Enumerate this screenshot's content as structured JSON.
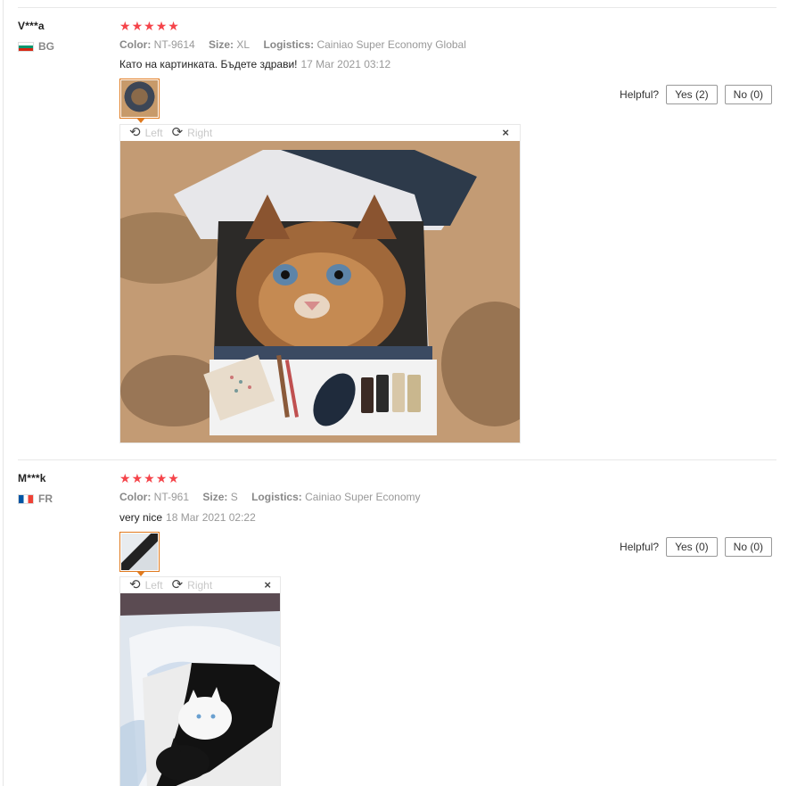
{
  "reviews": [
    {
      "user": "V***a",
      "country": "BG",
      "rating": 5,
      "attributes": {
        "color_label": "Color:",
        "color_value": "NT-9614",
        "size_label": "Size:",
        "size_value": "XL",
        "logistics_label": "Logistics:",
        "logistics_value": "Cainiao Super Economy Global"
      },
      "text": "Като на картинката. Бъдете здрави!",
      "date": "17 Mar 2021 03:12",
      "helpful_label": "Helpful?",
      "yes_label": "Yes (2)",
      "no_label": "No (0)",
      "viewer": {
        "left_label": "Left",
        "right_label": "Right",
        "close_label": "×"
      }
    },
    {
      "user": "M***k",
      "country": "FR",
      "rating": 5,
      "attributes": {
        "color_label": "Color:",
        "color_value": "NT-961",
        "size_label": "Size:",
        "size_value": "S",
        "logistics_label": "Logistics:",
        "logistics_value": "Cainiao Super Economy"
      },
      "text": "very nice",
      "date": "18 Mar 2021 02:22",
      "helpful_label": "Helpful?",
      "yes_label": "Yes (0)",
      "no_label": "No (0)",
      "viewer": {
        "left_label": "Left",
        "right_label": "Right",
        "close_label": "×"
      }
    }
  ],
  "icons": {
    "star": "★",
    "rotate_left": "⟲",
    "rotate_right": "⟳"
  },
  "colors": {
    "star": "#f5444a",
    "thumb_border": "#e07a1f"
  }
}
